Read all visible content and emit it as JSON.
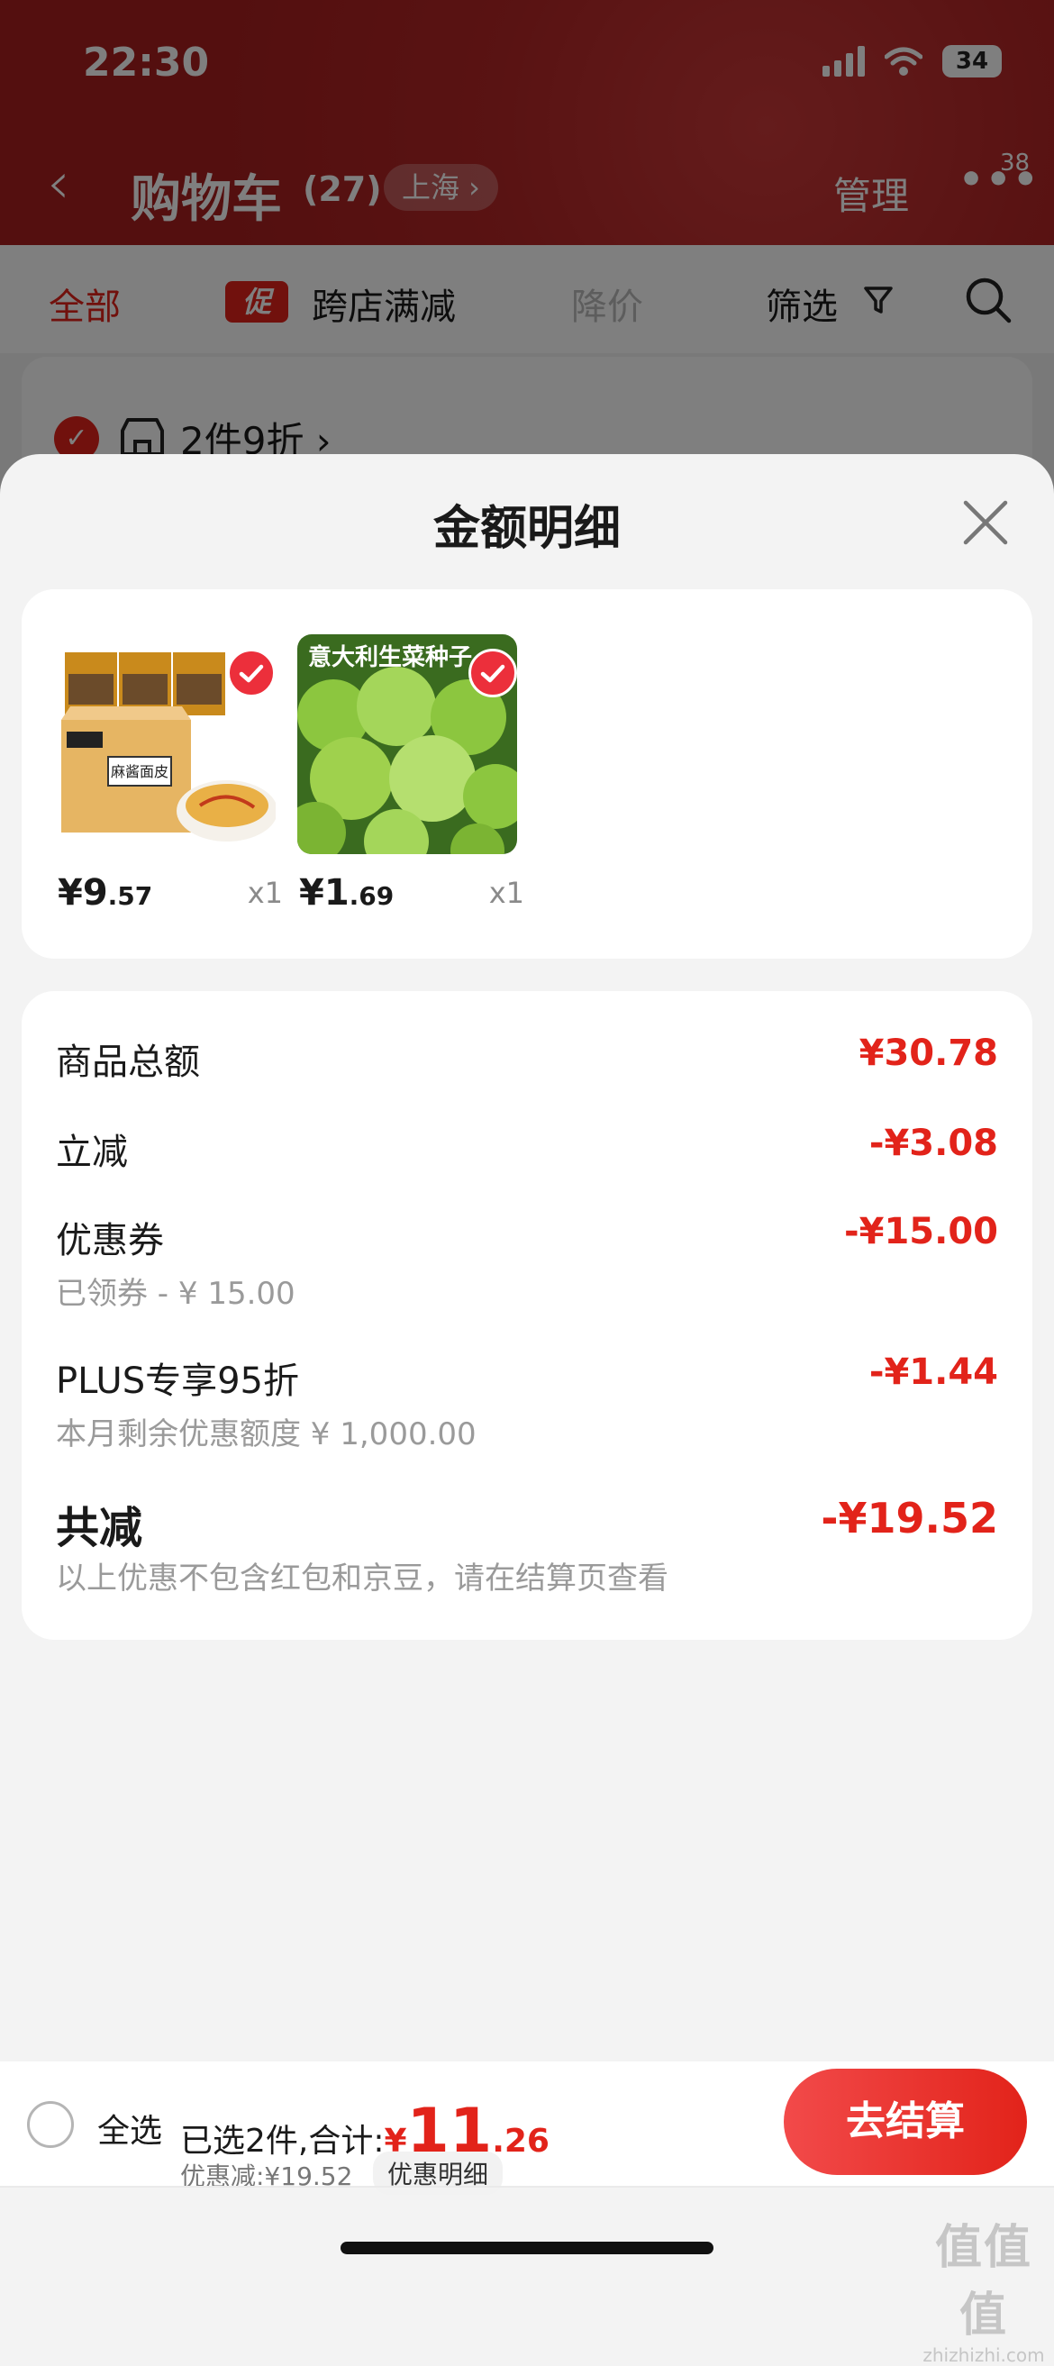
{
  "status_bar": {
    "time": "22:30",
    "battery": "34"
  },
  "nav": {
    "title": "购物车",
    "count": "(27)",
    "location": "上海 ›",
    "manage": "管理",
    "more": "•••",
    "badge": "38"
  },
  "filters": {
    "all": "全部",
    "promo_tag": "促",
    "cross_store": "跨店满减",
    "price_drop": "降价",
    "filter": "筛选"
  },
  "background_card": {
    "label": "2件9折 ›"
  },
  "sheet": {
    "title": "金额明细",
    "products": [
      {
        "name": "麻酱面皮",
        "price_int": "¥9",
        "price_dec": ".57",
        "qty": "x1",
        "image_text": "麻酱面皮"
      },
      {
        "name": "意大利生菜种子",
        "price_int": "¥1",
        "price_dec": ".69",
        "qty": "x1",
        "image_text": "意大利生菜种子"
      }
    ],
    "rows": {
      "goods_total": {
        "label": "商品总额",
        "value": "¥30.78"
      },
      "instant": {
        "label": "立减",
        "value": "-¥3.08"
      },
      "coupon": {
        "label": "优惠券",
        "value": "-¥15.00",
        "sub": "已领券 - ¥ 15.00"
      },
      "plus": {
        "label": "PLUS专享95折",
        "value": "-¥1.44",
        "sub": "本月剩余优惠额度  ¥ 1,000.00"
      },
      "total": {
        "label": "共减",
        "value": "-¥19.52",
        "sub": "以上优惠不包含红包和京豆，请在结算页查看"
      }
    }
  },
  "bottom_bar": {
    "select_all": "全选",
    "selected_text": "已选2件,合计:",
    "currency": "¥",
    "total_int": "11",
    "total_dec": ".26",
    "saved": "优惠减:¥19.52",
    "detail_link": "优惠明细",
    "checkout": "去结算"
  },
  "watermark": {
    "line1": "值值值",
    "line2": "zhizhizhi.com"
  },
  "colors": {
    "accent": "#e2231a",
    "header": "#b32626",
    "sheet_bg": "#f3f3f3"
  }
}
